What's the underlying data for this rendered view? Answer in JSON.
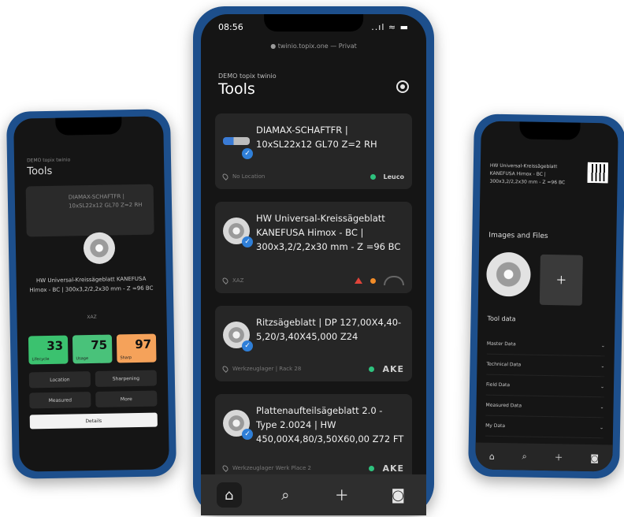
{
  "center": {
    "status": {
      "time": "08:56",
      "signal": "..ıl ≈ ▬"
    },
    "url": "● twinio.topix.one — Privat",
    "header": {
      "small_title": "DEMO topix twinio",
      "title": "Tools"
    },
    "cards": [
      {
        "name": "DIAMAX-SCHAFTFR | 10xSL22x12 GL70 Z=2 RH",
        "location": "No Location",
        "brand": "Leuco"
      },
      {
        "name": "HW Universal-Kreissägeblatt KANEFUSA Himox - BC | 300x3,2/2,2x30 mm - Z =96 BC",
        "location": "XAZ"
      },
      {
        "name": "Ritzsägeblatt | DP 127,00X4,40-5,20/3,40X45,000 Z24",
        "location": "Werkzeuglager | Rack 28",
        "brand": "AKE"
      },
      {
        "name": "Plattenaufteilsägeblatt 2.0 - Type 2.0024 | HW 450,00X4,80/3,50X60,00 Z72 FT",
        "location": "Werkzeuglager Werk Place 2",
        "brand": "AKE"
      }
    ],
    "tabs": [
      "home-icon",
      "search-icon",
      "plus-icon",
      "camera-icon"
    ]
  },
  "left": {
    "small_title": "DEMO topix twinio",
    "title": "Tools",
    "card_text": "DIAMAX-SCHAFTFR | 10xSL22x12 GL70 Z=2 RH",
    "description": "HW Universal-Kreissägeblatt KANEFUSA Himox - BC | 300x3,2/2,2x30 mm - Z =96 BC",
    "location": "XAZ",
    "stats": [
      {
        "value": "33",
        "label": "Lifecycle",
        "color": "#3bc26f"
      },
      {
        "value": "75",
        "label": "Usage",
        "color": "#49c27a"
      },
      {
        "value": "97",
        "label": "Sharp",
        "color": "#f5a25a"
      }
    ],
    "buttons": [
      "Location",
      "Sharpening",
      "Measured",
      "More"
    ],
    "details": "Details"
  },
  "right": {
    "header": "HW Universal-Kreissägeblatt KANEFUSA Himox - BC | 300x3,2/2,2x30 mm - Z =96 BC",
    "section_images": "Images and Files",
    "section_tooldata": "Tool data",
    "rows": [
      "Master Data",
      "Technical Data",
      "Field Data",
      "Measured Data",
      "My Data"
    ]
  },
  "colors": {
    "accent": "#2f7fd8",
    "ok": "#2ec27e",
    "warn": "#f28c28",
    "alert": "#e0443a",
    "frame": "#1d4f8c"
  }
}
